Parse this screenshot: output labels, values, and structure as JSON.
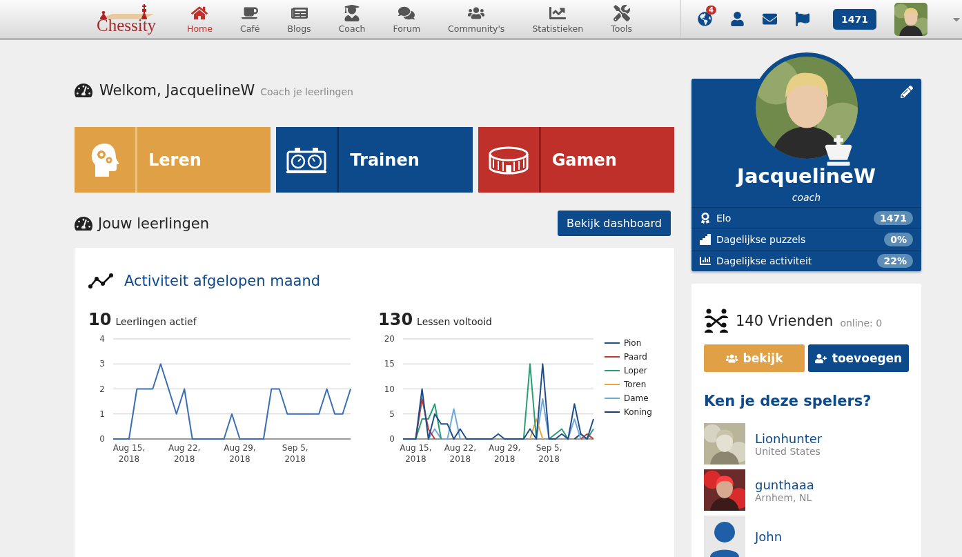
{
  "nav": {
    "logo": "Chessity",
    "items": [
      {
        "label": "Home",
        "kind": "home",
        "selected": true
      },
      {
        "label": "Café",
        "kind": "cafe",
        "selected": false
      },
      {
        "label": "Blogs",
        "kind": "blogs",
        "selected": false
      },
      {
        "label": "Coach",
        "kind": "coach",
        "selected": false
      },
      {
        "label": "Forum",
        "kind": "forum",
        "selected": false
      },
      {
        "label": "Community's",
        "kind": "community",
        "selected": false
      },
      {
        "label": "Statistieken",
        "kind": "stats",
        "selected": false
      },
      {
        "label": "Tools",
        "kind": "tools",
        "selected": false
      }
    ],
    "notifications": "4",
    "rating": "1471"
  },
  "welcome": {
    "title": "Welkom, JacquelineW",
    "subtitle": "Coach je leerlingen"
  },
  "tiles": [
    {
      "label": "Leren",
      "kind": "learn"
    },
    {
      "label": "Trainen",
      "kind": "train"
    },
    {
      "label": "Gamen",
      "kind": "game"
    }
  ],
  "students": {
    "title": "Jouw leerlingen",
    "button": "Bekijk dashboard"
  },
  "activity": {
    "title": "Activiteit afgelopen maand",
    "stats": [
      {
        "value": "10",
        "label": "Leerlingen actief",
        "chart_data": {
          "type": "line",
          "grid": true,
          "ylim": [
            0,
            4
          ],
          "yticks": [
            0,
            1,
            2,
            3,
            4
          ],
          "categories": [
            null,
            null,
            "Aug 15, 2018",
            null,
            null,
            null,
            null,
            null,
            null,
            "Aug 22, 2018",
            null,
            null,
            null,
            null,
            null,
            null,
            "Aug 29, 2018",
            null,
            null,
            null,
            null,
            null,
            null,
            "Sep 5, 2018",
            null,
            null,
            null,
            null,
            null,
            null,
            null
          ],
          "values": [
            0,
            0,
            0,
            2,
            2,
            2,
            3,
            2,
            1,
            2,
            0,
            0,
            0,
            0,
            0,
            1,
            0,
            0,
            0,
            0,
            2,
            2,
            1,
            1,
            1,
            1,
            1,
            2,
            1,
            1,
            2
          ]
        }
      },
      {
        "value": "130",
        "label": "Lessen voltooid",
        "chart_data": {
          "type": "line",
          "grid": true,
          "legend": "right",
          "ylim": [
            0,
            20
          ],
          "yticks": [
            0,
            5,
            10,
            15,
            20
          ],
          "categories": [
            null,
            null,
            "Aug 15, 2018",
            null,
            null,
            null,
            null,
            null,
            null,
            "Aug 22, 2018",
            null,
            null,
            null,
            null,
            null,
            null,
            "Aug 29, 2018",
            null,
            null,
            null,
            null,
            null,
            null,
            "Sep 5, 2018",
            null,
            null,
            null,
            null,
            null,
            null,
            null
          ],
          "series": [
            {
              "name": "Pion",
              "color": "#1f4e8c",
              "values": [
                0,
                0,
                0,
                10,
                0,
                5,
                3,
                3,
                0,
                2,
                0,
                0,
                0,
                0,
                0,
                1,
                0,
                0,
                0,
                0,
                2,
                0,
                15,
                0,
                0,
                1,
                0,
                7,
                1,
                0,
                4
              ]
            },
            {
              "name": "Paard",
              "color": "#c0392b",
              "values": [
                null,
                null,
                0,
                8,
                2,
                0,
                null,
                null,
                null,
                null,
                null,
                null,
                null,
                null,
                null,
                null,
                null,
                null,
                null,
                null,
                null,
                null,
                null,
                null,
                null,
                null,
                null,
                null,
                0,
                1,
                0
              ]
            },
            {
              "name": "Loper",
              "color": "#2a9d72",
              "values": [
                null,
                null,
                0,
                4,
                4,
                7,
                0,
                null,
                null,
                null,
                null,
                null,
                null,
                null,
                null,
                null,
                null,
                null,
                null,
                0,
                15,
                0,
                null,
                0,
                1,
                2,
                0,
                null,
                null,
                0,
                2
              ]
            },
            {
              "name": "Toren",
              "color": "#e8a33d",
              "values": [
                null,
                null,
                null,
                null,
                null,
                null,
                null,
                null,
                null,
                null,
                null,
                null,
                null,
                null,
                null,
                null,
                null,
                null,
                null,
                null,
                0,
                4,
                0,
                null,
                null,
                null,
                null,
                null,
                null,
                null,
                null
              ]
            },
            {
              "name": "Dame",
              "color": "#6fa8dc",
              "values": [
                null,
                null,
                null,
                null,
                0,
                2,
                0,
                0,
                6,
                0,
                null,
                null,
                null,
                null,
                null,
                null,
                null,
                null,
                null,
                null,
                null,
                0,
                8,
                0,
                null,
                null,
                0,
                4,
                0,
                null,
                null
              ]
            },
            {
              "name": "Koning",
              "color": "#173d6b",
              "values": [
                null,
                null,
                null,
                null,
                null,
                null,
                null,
                null,
                null,
                null,
                null,
                null,
                null,
                null,
                null,
                null,
                null,
                null,
                null,
                null,
                null,
                null,
                null,
                null,
                null,
                null,
                null,
                0,
                1,
                0,
                null
              ]
            }
          ]
        }
      }
    ]
  },
  "profile": {
    "name": "JacquelineW",
    "role": "coach",
    "stats": [
      {
        "kind": "elo",
        "label": "Elo",
        "value": "1471"
      },
      {
        "kind": "puzzles",
        "label": "Dagelijkse puzzels",
        "value": "0%"
      },
      {
        "kind": "activity",
        "label": "Dagelijkse activiteit",
        "value": "22%"
      }
    ]
  },
  "friends": {
    "title": "140 Vrienden",
    "online": "online: 0",
    "buttons": [
      {
        "label": "bekijk",
        "kind": "view"
      },
      {
        "label": "toevoegen",
        "kind": "add"
      }
    ],
    "suggest_title": "Ken je deze spelers?",
    "players": [
      {
        "name": "Lionhunter",
        "location": "United States",
        "kind": "picture"
      },
      {
        "name": "gunthaaa",
        "location": "Arnhem, NL",
        "kind": "picture"
      },
      {
        "name": "John",
        "kind": "default"
      }
    ]
  }
}
